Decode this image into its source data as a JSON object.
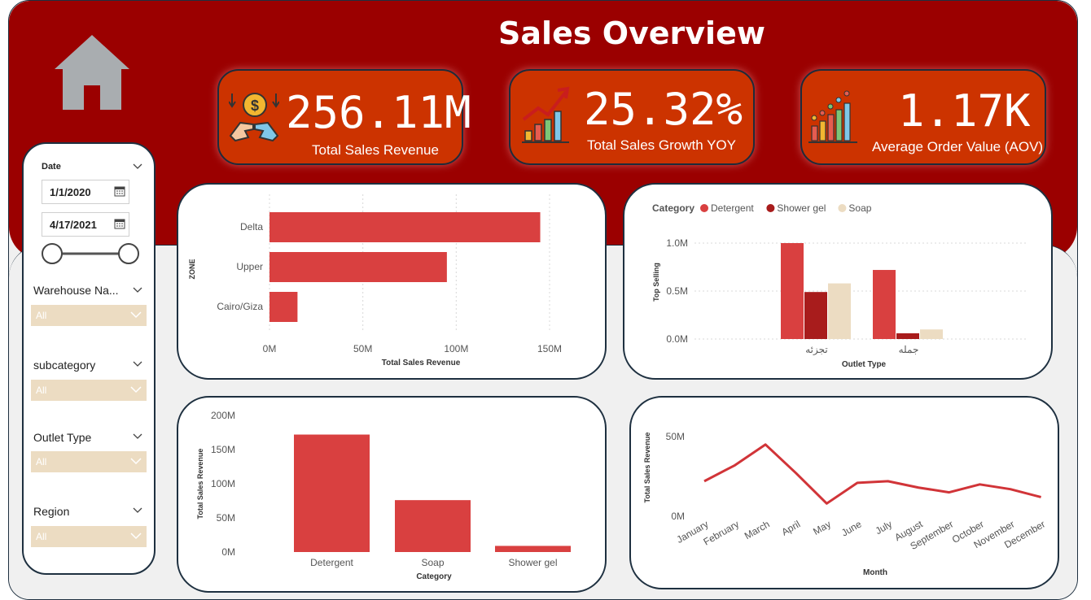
{
  "header": {
    "title": "Sales Overview"
  },
  "kpis": [
    {
      "value": "256.11M",
      "label": "Total Sales Revenue",
      "icon": "money-hands-icon"
    },
    {
      "value": "25.32%",
      "label": "Total Sales Growth YOY",
      "icon": "growth-chart-icon"
    },
    {
      "value": "1.17K",
      "label": "Average Order Value (AOV)",
      "icon": "bar-chart-icon"
    }
  ],
  "filters": {
    "date": {
      "label": "Date",
      "start": "1/1/2020",
      "end": "4/17/2021"
    },
    "dropdowns": [
      {
        "label": "Warehouse Na...",
        "value": "All"
      },
      {
        "label": "subcategory",
        "value": "All"
      },
      {
        "label": "Outlet Type",
        "value": "All"
      },
      {
        "label": "Region",
        "value": "All"
      }
    ]
  },
  "colors": {
    "banner": "#9b0000",
    "kpi": "#cc3300",
    "detergent": "#d94040",
    "shower_gel": "#a81c1c",
    "soap": "#ecdcc2",
    "line": "#d13438"
  },
  "chart_data": [
    {
      "type": "bar",
      "orientation": "horizontal",
      "categories": [
        "Delta",
        "Upper",
        "Cairo/Giza"
      ],
      "values": [
        145,
        95,
        15
      ],
      "xlabel": "Total Sales Revenue",
      "ylabel": "ZONE",
      "xticks": [
        "0M",
        "50M",
        "100M",
        "150M"
      ],
      "xlim": [
        0,
        150
      ],
      "units": "M"
    },
    {
      "type": "bar",
      "legend_title": "Category",
      "categories": [
        "تجزئه",
        "جمله"
      ],
      "series": [
        {
          "name": "Detergent",
          "values": [
            1.0,
            0.72
          ]
        },
        {
          "name": "Shower gel",
          "values": [
            0.49,
            0.06
          ]
        },
        {
          "name": "Soap",
          "values": [
            0.58,
            0.1
          ]
        }
      ],
      "xlabel": "Outlet Type",
      "ylabel": "Top Selling",
      "yticks": [
        "1.0M",
        "0.5M",
        "0.0M"
      ],
      "ylim": [
        0,
        1.0
      ],
      "units": "M",
      "legend_position": "top-left"
    },
    {
      "type": "bar",
      "categories": [
        "Detergent",
        "Soap",
        "Shower gel"
      ],
      "values": [
        172,
        76,
        9
      ],
      "xlabel": "Category",
      "ylabel": "Total Sales Revenue",
      "yticks": [
        "200M",
        "150M",
        "100M",
        "50M",
        "0M"
      ],
      "ylim": [
        0,
        200
      ],
      "units": "M"
    },
    {
      "type": "line",
      "x": [
        "January",
        "February",
        "March",
        "April",
        "May",
        "June",
        "July",
        "August",
        "September",
        "October",
        "November",
        "December"
      ],
      "values": [
        22,
        32,
        45,
        27,
        8,
        21,
        22,
        18,
        15,
        20,
        17,
        12
      ],
      "xlabel": "Month",
      "ylabel": "Total Sales Revenue",
      "yticks": [
        "50M",
        "0M"
      ],
      "ylim": [
        0,
        50
      ],
      "units": "M"
    }
  ]
}
